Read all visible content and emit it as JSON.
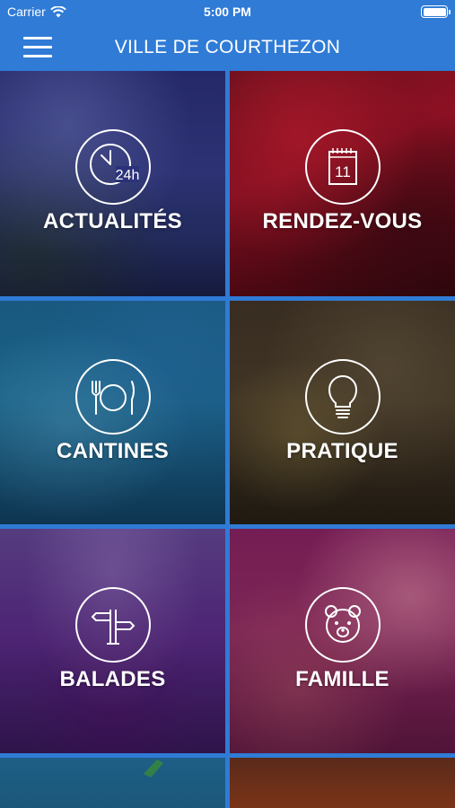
{
  "status": {
    "carrier": "Carrier",
    "time": "5:00 PM"
  },
  "header": {
    "title": "VILLE DE COURTHEZON"
  },
  "tiles": [
    {
      "label": "ACTUALITÉS",
      "icon": "clock-24h-icon"
    },
    {
      "label": "RENDEZ-VOUS",
      "icon": "calendar-icon",
      "icon_text": "11"
    },
    {
      "label": "CANTINES",
      "icon": "fork-plate-knife-icon"
    },
    {
      "label": "PRATIQUE",
      "icon": "lightbulb-icon"
    },
    {
      "label": "BALADES",
      "icon": "signpost-icon"
    },
    {
      "label": "FAMILLE",
      "icon": "teddy-bear-icon"
    }
  ],
  "icon_clock": {
    "text": "24h"
  },
  "colors": {
    "accent": "#2f7bd6",
    "text": "#ffffff"
  }
}
